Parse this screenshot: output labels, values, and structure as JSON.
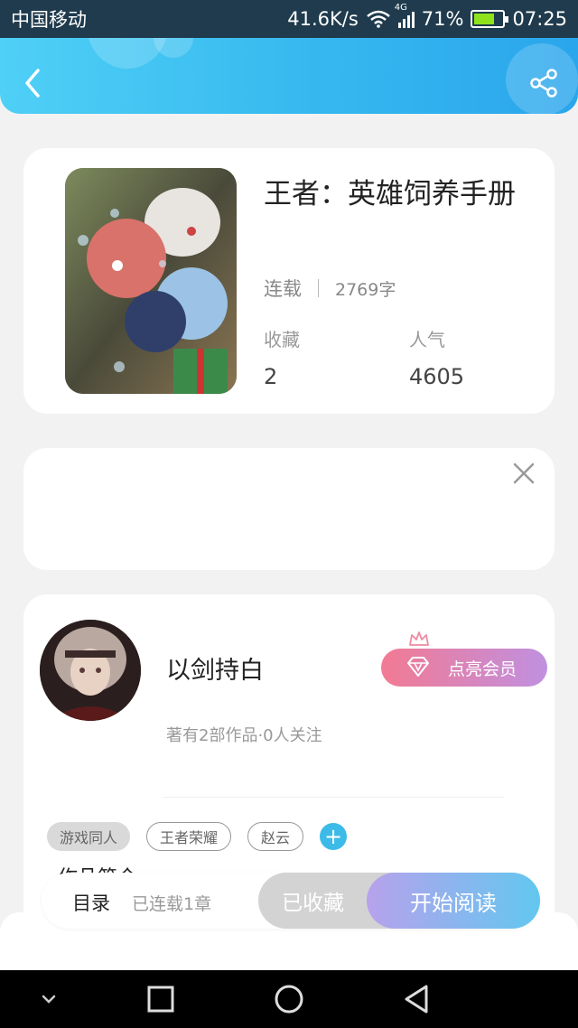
{
  "status_bar": {
    "carrier": "中国移动",
    "speed": "41.6K/s",
    "network": "4G",
    "battery": "71%",
    "battery_level": 0.71,
    "time": "07:25"
  },
  "header": {
    "back_icon": "chevron-left-icon",
    "share_icon": "share-icon",
    "gradient_start": "#4fd0f6",
    "gradient_end": "#2aa6ec"
  },
  "book": {
    "title": "王者：英雄饲养手册",
    "status": "连载",
    "word_count": "2769字",
    "stats": [
      {
        "label": "收藏",
        "value": "2"
      },
      {
        "label": "人气",
        "value": "4605"
      }
    ]
  },
  "ad": {
    "close_icon": "close-icon"
  },
  "author": {
    "name": "以剑持白",
    "meta": "著有2部作品·0人关注",
    "vip_label": "点亮会员",
    "vip_icon": "diamond-icon",
    "tags": [
      "游戏同人",
      "王者荣耀",
      "赵云"
    ],
    "add_tag_symbol": "+",
    "works_heading": "作品简介"
  },
  "action_bar": {
    "toc_label": "目录",
    "toc_status": "已连载1章",
    "collected_label": "已收藏",
    "read_label": "开始阅读"
  },
  "nav": {
    "icons": [
      "collapse-icon",
      "recent-apps-icon",
      "home-icon",
      "back-icon"
    ]
  }
}
